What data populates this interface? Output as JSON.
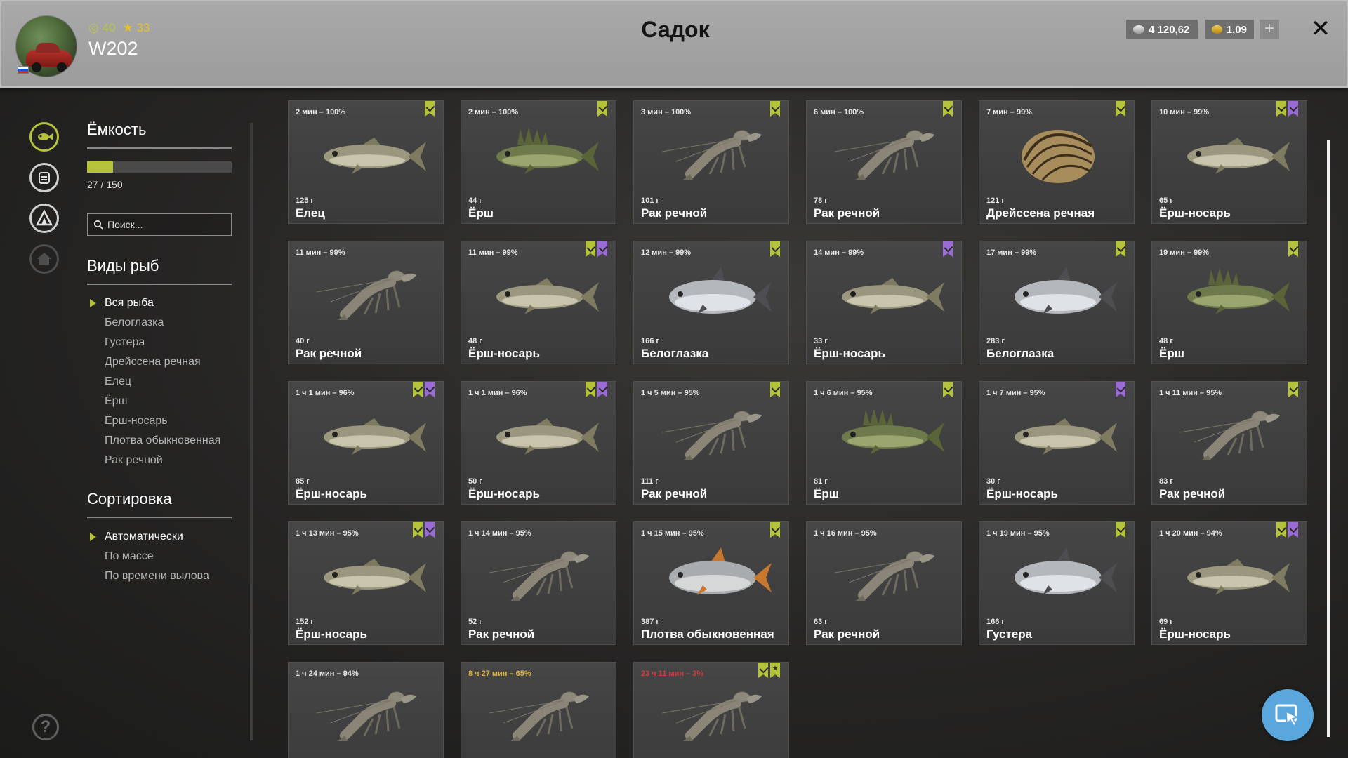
{
  "header": {
    "title": "Садок",
    "username": "W202",
    "level": "40",
    "stars": "33",
    "silver": "4 120,62",
    "gold": "1,09",
    "plus": "+",
    "close": "✕"
  },
  "colors": {
    "accent": "#b5c33a",
    "favorite": "#9a6bd6",
    "header": "#a3a3a3"
  },
  "capacity": {
    "title": "Ёмкость",
    "count": "27 / 150",
    "fill_fraction": 0.18
  },
  "search": {
    "placeholder": "Поиск..."
  },
  "species": {
    "title": "Виды рыб",
    "items": [
      "Вся рыба",
      "Белоглазка",
      "Густера",
      "Дрейссена речная",
      "Елец",
      "Ёрш",
      "Ёрш-носарь",
      "Плотва обыкновенная",
      "Рак речной"
    ],
    "selected_index": 0
  },
  "sorting": {
    "title": "Сортировка",
    "items": [
      "Автоматически",
      "По массе",
      "По времени вылова"
    ],
    "selected_index": 0
  },
  "help": "?",
  "catches": [
    {
      "time": "2 мин – 100%",
      "weight": "125 г",
      "name": "Елец",
      "kind": "fish",
      "badges": [
        "g"
      ]
    },
    {
      "time": "2 мин – 100%",
      "weight": "44 г",
      "name": "Ёрш",
      "kind": "ruff",
      "badges": [
        "g"
      ]
    },
    {
      "time": "3 мин – 100%",
      "weight": "101 г",
      "name": "Рак речной",
      "kind": "crayfish",
      "badges": [
        "g"
      ]
    },
    {
      "time": "6 мин – 100%",
      "weight": "78 г",
      "name": "Рак речной",
      "kind": "crayfish",
      "badges": [
        "g"
      ]
    },
    {
      "time": "7 мин – 99%",
      "weight": "121 г",
      "name": "Дрейссена речная",
      "kind": "mussel",
      "badges": [
        "g"
      ]
    },
    {
      "time": "10 мин – 99%",
      "weight": "65 г",
      "name": "Ёрш-носарь",
      "kind": "fish",
      "badges": [
        "g",
        "p"
      ]
    },
    {
      "time": "11 мин – 99%",
      "weight": "40 г",
      "name": "Рак речной",
      "kind": "crayfish",
      "badges": []
    },
    {
      "time": "11 мин – 99%",
      "weight": "48 г",
      "name": "Ёрш-носарь",
      "kind": "fish",
      "badges": [
        "g",
        "p"
      ]
    },
    {
      "time": "12 мин – 99%",
      "weight": "166 г",
      "name": "Белоглазка",
      "kind": "bream",
      "badges": [
        "g"
      ]
    },
    {
      "time": "14 мин – 99%",
      "weight": "33 г",
      "name": "Ёрш-носарь",
      "kind": "fish",
      "badges": [
        "p"
      ]
    },
    {
      "time": "17 мин – 99%",
      "weight": "283 г",
      "name": "Белоглазка",
      "kind": "bream",
      "badges": [
        "g"
      ]
    },
    {
      "time": "19 мин – 99%",
      "weight": "48 г",
      "name": "Ёрш",
      "kind": "ruff",
      "badges": [
        "g"
      ]
    },
    {
      "time": "1 ч 1 мин – 96%",
      "weight": "85 г",
      "name": "Ёрш-носарь",
      "kind": "fish",
      "badges": [
        "g",
        "p"
      ]
    },
    {
      "time": "1 ч 1 мин – 96%",
      "weight": "50 г",
      "name": "Ёрш-носарь",
      "kind": "fish",
      "badges": [
        "g",
        "p"
      ]
    },
    {
      "time": "1 ч 5 мин – 95%",
      "weight": "111 г",
      "name": "Рак речной",
      "kind": "crayfish",
      "badges": [
        "g"
      ]
    },
    {
      "time": "1 ч 6 мин – 95%",
      "weight": "81 г",
      "name": "Ёрш",
      "kind": "ruff",
      "badges": [
        "g"
      ]
    },
    {
      "time": "1 ч 7 мин – 95%",
      "weight": "30 г",
      "name": "Ёрш-носарь",
      "kind": "fish",
      "badges": [
        "p"
      ]
    },
    {
      "time": "1 ч 11 мин – 95%",
      "weight": "83 г",
      "name": "Рак речной",
      "kind": "crayfish",
      "badges": [
        "g"
      ]
    },
    {
      "time": "1 ч 13 мин – 95%",
      "weight": "152 г",
      "name": "Ёрш-носарь",
      "kind": "fish",
      "badges": [
        "g",
        "p"
      ]
    },
    {
      "time": "1 ч 14 мин – 95%",
      "weight": "52 г",
      "name": "Рак речной",
      "kind": "crayfish",
      "badges": []
    },
    {
      "time": "1 ч 15 мин – 95%",
      "weight": "387 г",
      "name": "Плотва обыкновенная",
      "kind": "roach",
      "badges": [
        "g"
      ]
    },
    {
      "time": "1 ч 16 мин – 95%",
      "weight": "63 г",
      "name": "Рак речной",
      "kind": "crayfish",
      "badges": []
    },
    {
      "time": "1 ч 19 мин – 95%",
      "weight": "166 г",
      "name": "Густера",
      "kind": "bream",
      "badges": [
        "g"
      ]
    },
    {
      "time": "1 ч 20 мин – 94%",
      "weight": "69 г",
      "name": "Ёрш-носарь",
      "kind": "fish",
      "badges": [
        "g",
        "p"
      ]
    },
    {
      "time": "1 ч 24 мин – 94%",
      "weight": "",
      "name": "",
      "kind": "crayfish",
      "badges": []
    },
    {
      "time": "8 ч 27 мин – 65%",
      "weight": "",
      "name": "",
      "kind": "crayfish",
      "badges": [],
      "status": "warn"
    },
    {
      "time": "23 ч 11 мин – 3%",
      "weight": "",
      "name": "",
      "kind": "crayfish",
      "badges": [
        "g",
        "s"
      ],
      "status": "bad"
    }
  ]
}
